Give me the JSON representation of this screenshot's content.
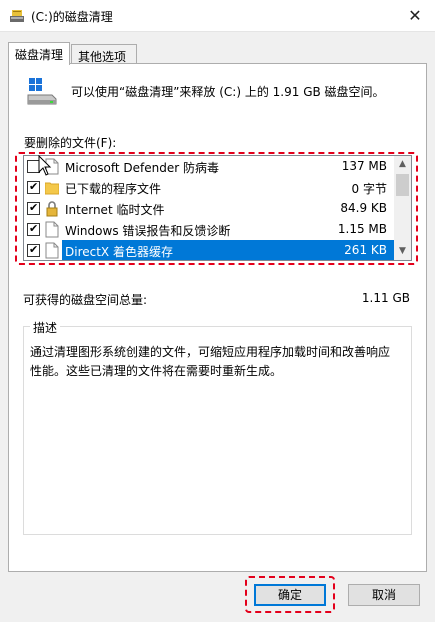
{
  "window": {
    "title": "(C:)的磁盘清理",
    "close_glyph": "✕"
  },
  "tabs": [
    {
      "label": "磁盘清理"
    },
    {
      "label": "其他选项"
    }
  ],
  "header": {
    "message": "可以使用“磁盘清理”来释放  (C:) 上的 1.91 GB 磁盘空间。"
  },
  "files": {
    "label": "要删除的文件(F):",
    "items": [
      {
        "name": "Microsoft Defender 防病毒",
        "size": "137 MB",
        "checked": false,
        "icon": "file-icon"
      },
      {
        "name": "已下载的程序文件",
        "size": "0 字节",
        "checked": true,
        "icon": "folder-icon"
      },
      {
        "name": "Internet 临时文件",
        "size": "84.9 KB",
        "checked": true,
        "icon": "lock-icon"
      },
      {
        "name": "Windows 错误报告和反馈诊断",
        "size": "1.15 MB",
        "checked": true,
        "icon": "file-icon"
      },
      {
        "name": "DirectX 着色器缓存",
        "size": "261 KB",
        "checked": true,
        "icon": "file-icon",
        "selected": true
      }
    ]
  },
  "total": {
    "label": "可获得的磁盘空间总量:",
    "value": "1.11 GB"
  },
  "description": {
    "legend": "描述",
    "text": "通过清理图形系统创建的文件，可缩短应用程序加载时间和改善响应性能。这些已清理的文件将在需要时重新生成。"
  },
  "buttons": {
    "ok": "确定",
    "cancel": "取消"
  },
  "colors": {
    "selection": "#0078d7",
    "highlight_dash": "#e3001b"
  }
}
